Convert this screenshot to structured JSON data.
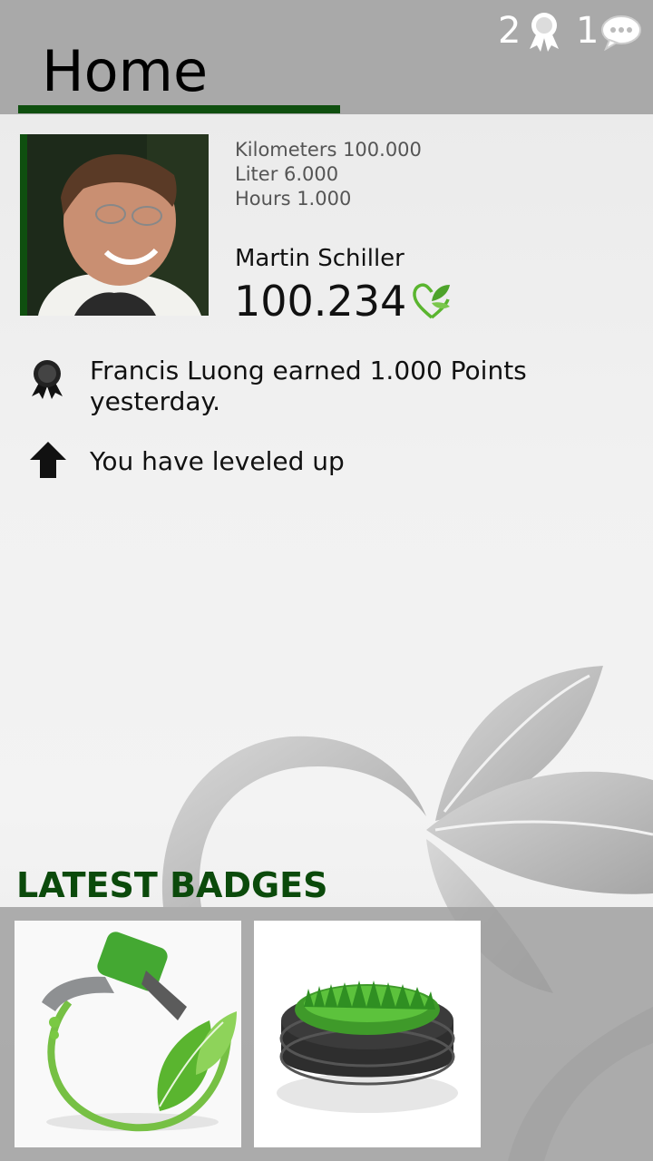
{
  "header": {
    "title": "Home",
    "badge_count": "2",
    "message_count": "1"
  },
  "profile": {
    "stats": [
      "Kilometers 100.000",
      "Liter 6.000",
      "Hours 1.000"
    ],
    "name": "Martin Schiller",
    "points": "100.234"
  },
  "feed": [
    {
      "icon": "award-ribbon-icon",
      "text": "Francis Luong earned 1.000 Points yesterday."
    },
    {
      "icon": "arrow-up-icon",
      "text": "You have leveled up"
    }
  ],
  "badges": {
    "title": "LATEST BADGES",
    "items": [
      {
        "name": "eco-fuel-nozzle-badge"
      },
      {
        "name": "grass-tire-badge"
      }
    ]
  },
  "colors": {
    "accent_dark_green": "#0f4f0f",
    "leaf_green": "#5ab52f",
    "header_gray": "#a9a9a9"
  }
}
